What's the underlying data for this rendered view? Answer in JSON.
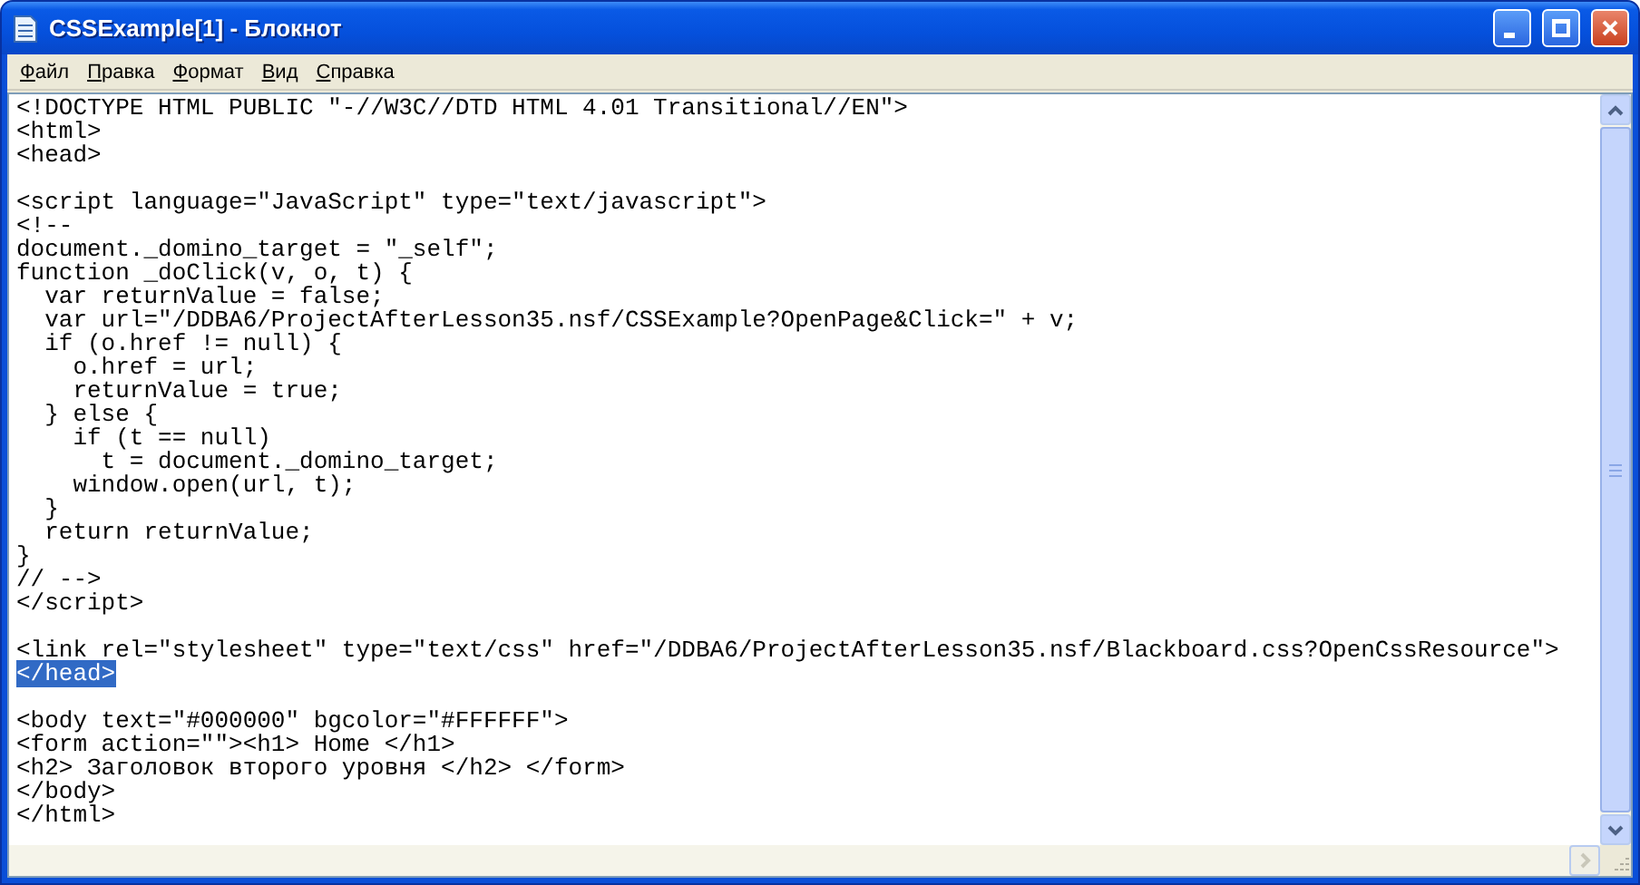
{
  "window": {
    "title": "CSSExample[1] - Блокнот"
  },
  "menu": [
    {
      "label": "Файл"
    },
    {
      "label": "Правка"
    },
    {
      "label": "Формат"
    },
    {
      "label": "Вид"
    },
    {
      "label": "Справка"
    }
  ],
  "editor": {
    "lines": [
      {
        "kind": "text",
        "text": "<!DOCTYPE HTML PUBLIC \"-//W3C//DTD HTML 4.01 Transitional//EN\">",
        "selected": false
      },
      {
        "kind": "text",
        "text": "<html>",
        "selected": false
      },
      {
        "kind": "text",
        "text": "<head>",
        "selected": false
      },
      {
        "kind": "blank"
      },
      {
        "kind": "text",
        "text": "<script language=\"JavaScript\" type=\"text/javascript\">",
        "selected": false
      },
      {
        "kind": "text",
        "text": "<!--",
        "selected": false
      },
      {
        "kind": "text",
        "text": "document._domino_target = \"_self\";",
        "selected": false
      },
      {
        "kind": "text",
        "text": "function _doClick(v, o, t) {",
        "selected": false
      },
      {
        "kind": "text",
        "text": "  var returnValue = false;",
        "selected": false
      },
      {
        "kind": "text",
        "text": "  var url=\"/DDBA6/ProjectAfterLesson35.nsf/CSSExample?OpenPage&Click=\" + v;",
        "selected": false
      },
      {
        "kind": "text",
        "text": "  if (o.href != null) {",
        "selected": false
      },
      {
        "kind": "text",
        "text": "    o.href = url;",
        "selected": false
      },
      {
        "kind": "text",
        "text": "    returnValue = true;",
        "selected": false
      },
      {
        "kind": "text",
        "text": "  } else {",
        "selected": false
      },
      {
        "kind": "text",
        "text": "    if (t == null)",
        "selected": false
      },
      {
        "kind": "text",
        "text": "      t = document._domino_target;",
        "selected": false
      },
      {
        "kind": "text",
        "text": "    window.open(url, t);",
        "selected": false
      },
      {
        "kind": "text",
        "text": "  }",
        "selected": false
      },
      {
        "kind": "text",
        "text": "  return returnValue;",
        "selected": false
      },
      {
        "kind": "text",
        "text": "}",
        "selected": false
      },
      {
        "kind": "text",
        "text": "// -->",
        "selected": false
      },
      {
        "kind": "text",
        "text": "</script>",
        "selected": false
      },
      {
        "kind": "blank"
      },
      {
        "kind": "text",
        "text": "<link rel=\"stylesheet\" type=\"text/css\" href=\"/DDBA6/ProjectAfterLesson35.nsf/Blackboard.css?OpenCssResource\">",
        "selected": false
      },
      {
        "kind": "text",
        "text": "</head>",
        "selected": true
      },
      {
        "kind": "blank"
      },
      {
        "kind": "text",
        "text": "<body text=\"#000000\" bgcolor=\"#FFFFFF\">",
        "selected": false
      },
      {
        "kind": "text",
        "text": "<form action=\"\"><h1> Home </h1>",
        "selected": false
      },
      {
        "kind": "text",
        "text": "<h2> Заголовок второго уровня </h2> </form>",
        "selected": false
      },
      {
        "kind": "text",
        "text": "</body>",
        "selected": false
      },
      {
        "kind": "text",
        "text": "</html>",
        "selected": false
      }
    ]
  }
}
